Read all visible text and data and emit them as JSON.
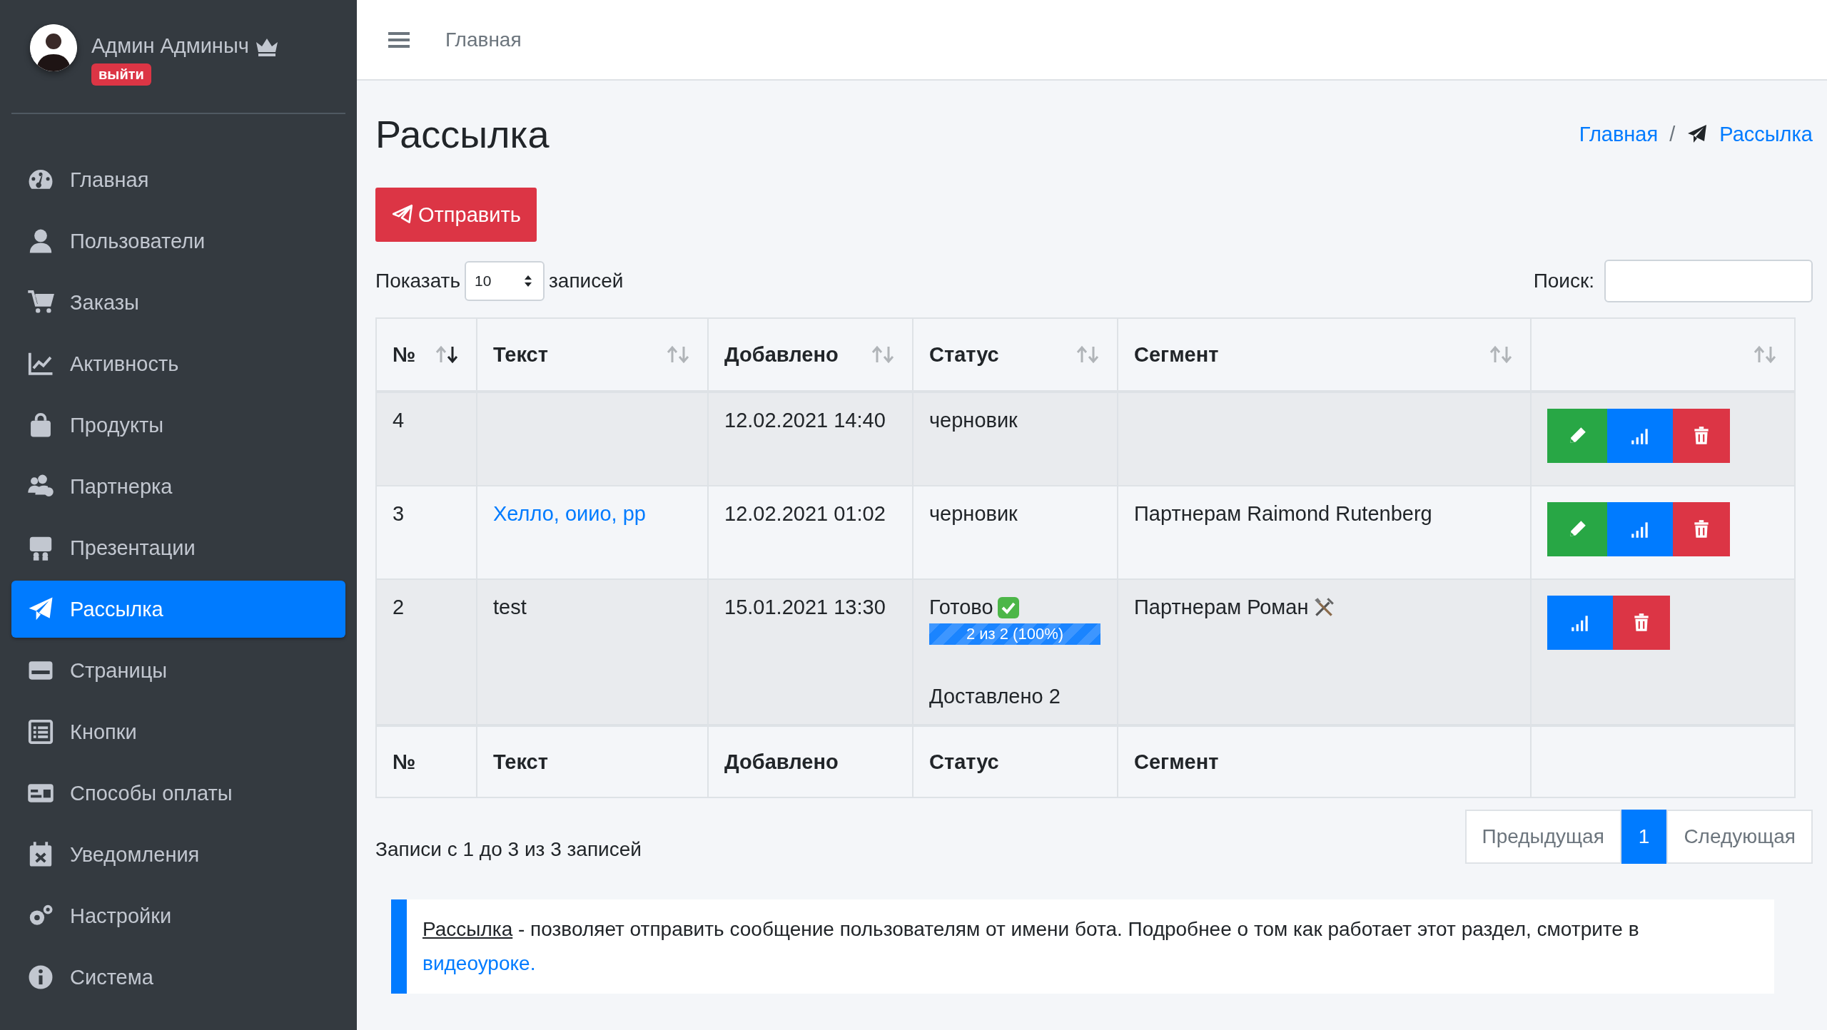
{
  "user": {
    "name": "Админ Админыч",
    "logout": "выйти"
  },
  "sidebar": {
    "items": [
      {
        "label": "Главная",
        "selected": false
      },
      {
        "label": "Пользователи",
        "selected": false
      },
      {
        "label": "Заказы",
        "selected": false
      },
      {
        "label": "Активность",
        "selected": false
      },
      {
        "label": "Продукты",
        "selected": false
      },
      {
        "label": "Партнерка",
        "selected": false
      },
      {
        "label": "Презентации",
        "selected": false
      },
      {
        "label": "Рассылка",
        "selected": true
      },
      {
        "label": "Страницы",
        "selected": false
      },
      {
        "label": "Кнопки",
        "selected": false
      },
      {
        "label": "Способы оплаты",
        "selected": false
      },
      {
        "label": "Уведомления",
        "selected": false
      },
      {
        "label": "Настройки",
        "selected": false
      },
      {
        "label": "Система",
        "selected": false
      }
    ]
  },
  "topbar": {
    "link": "Главная"
  },
  "page": {
    "title": "Рассылка",
    "breadcrumbs": [
      "Главная",
      "Рассылка"
    ],
    "breadcrumb_separator": "/",
    "send_button": "Отправить"
  },
  "length_control": {
    "prefix": "Показать",
    "value": "10",
    "suffix": "записей"
  },
  "search": {
    "label": "Поиск:"
  },
  "table": {
    "columns": [
      {
        "label": "№",
        "sorted": true
      },
      {
        "label": "Текст",
        "sorted": false
      },
      {
        "label": "Добавлено",
        "sorted": false
      },
      {
        "label": "Статус",
        "sorted": false
      },
      {
        "label": "Сегмент",
        "sorted": false
      },
      {
        "sorted": false
      }
    ],
    "rows": [
      {
        "number": "4",
        "added": "12.02.2021 14:40",
        "status": "черновик",
        "actions": [
          {
            "kind": "edit"
          },
          {
            "kind": "stats"
          },
          {
            "kind": "delete"
          }
        ]
      },
      {
        "number": "3",
        "text": "Хелло, оиио, рр",
        "text_link": true,
        "added": "12.02.2021 01:02",
        "status": "черновик",
        "segment": "Партнерам Raimond Rutenberg",
        "actions": [
          {
            "kind": "edit"
          },
          {
            "kind": "stats"
          },
          {
            "kind": "delete"
          }
        ]
      },
      {
        "number": "2",
        "text": "test",
        "text_link": false,
        "added": "15.01.2021 13:30",
        "status": "Готово",
        "done": true,
        "progress": {
          "label": "2 из 2 (100%)",
          "level": 1
        },
        "delivered": "Доставлено 2",
        "segment": "Партнерам Роман",
        "segment_tools": true,
        "actions": [
          {
            "kind": "stats"
          },
          {
            "kind": "delete"
          }
        ]
      }
    ],
    "footer": [
      "№",
      "Текст",
      "Добавлено",
      "Статус",
      "Сегмент"
    ]
  },
  "summary": "Записи с 1 до 3 из 3 записей",
  "pagination": {
    "previous": "Предыдущая",
    "pages": [
      {
        "label": "1",
        "selected": true
      }
    ],
    "next": "Следующая"
  },
  "info": {
    "link": "Рассылка",
    "text": " - позволяет отправить сообщение пользователям от имени бота. Подробнее о том как работает этот раздел, смотрите в ",
    "video_link": "видеоуроке."
  }
}
